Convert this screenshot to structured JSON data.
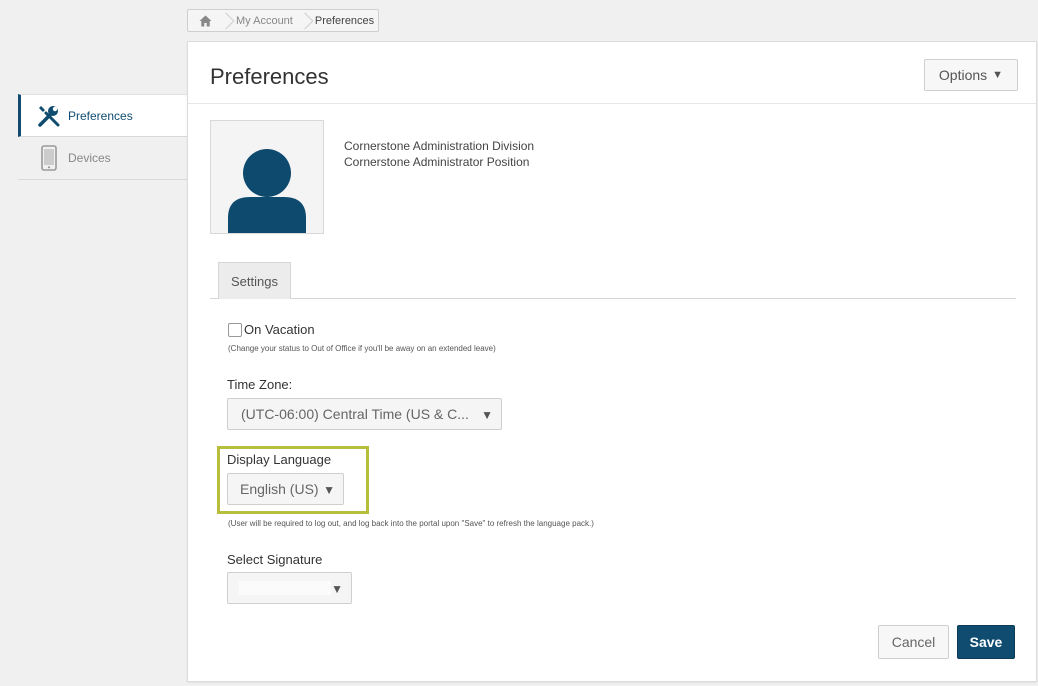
{
  "breadcrumb": {
    "items": [
      "My Account",
      "Preferences"
    ]
  },
  "sidebar": {
    "items": [
      {
        "label": "Preferences",
        "icon": "tools-icon",
        "active": true
      },
      {
        "label": "Devices",
        "icon": "phone-icon",
        "active": false
      }
    ]
  },
  "header": {
    "title": "Preferences",
    "options_label": "Options"
  },
  "profile": {
    "division": "Cornerstone Administration Division",
    "position": "Cornerstone Administrator Position"
  },
  "tabs": [
    {
      "label": "Settings"
    }
  ],
  "settings": {
    "vacation_label": "On Vacation",
    "vacation_checked": false,
    "vacation_help": "(Change your status to Out of Office if you'll be away on an extended leave)",
    "timezone_label": "Time Zone:",
    "timezone_value": "(UTC-06:00) Central Time (US & C...",
    "language_label": "Display Language",
    "language_value": "English (US)",
    "language_help": "(User will be required to log out, and log back into the portal upon \"Save\" to refresh the language pack.)",
    "signature_label": "Select Signature",
    "signature_value": ""
  },
  "actions": {
    "cancel": "Cancel",
    "save": "Save"
  },
  "colors": {
    "brand": "#0f4c70",
    "highlight": "#b6be3c"
  }
}
